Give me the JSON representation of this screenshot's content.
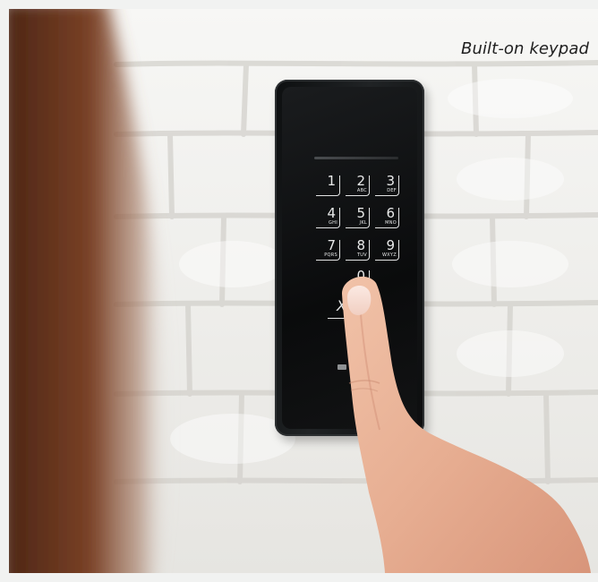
{
  "caption": "Built-on keypad",
  "keypad": {
    "keys": [
      {
        "digit": "1",
        "letters": ""
      },
      {
        "digit": "2",
        "letters": "ABC"
      },
      {
        "digit": "3",
        "letters": "DEF"
      },
      {
        "digit": "4",
        "letters": "GHI"
      },
      {
        "digit": "5",
        "letters": "JKL"
      },
      {
        "digit": "6",
        "letters": "MNO"
      },
      {
        "digit": "7",
        "letters": "PQRS"
      },
      {
        "digit": "8",
        "letters": "TUV"
      },
      {
        "digit": "9",
        "letters": "WXYZ"
      },
      {
        "digit": "0",
        "letters": ""
      }
    ],
    "clear_key": "X"
  },
  "colors": {
    "wall": "#f0efec",
    "keypad_body": "#121416",
    "key_glyph": "#e9eaea",
    "skin": "#e9b59c",
    "hair": "#6b3a22"
  }
}
